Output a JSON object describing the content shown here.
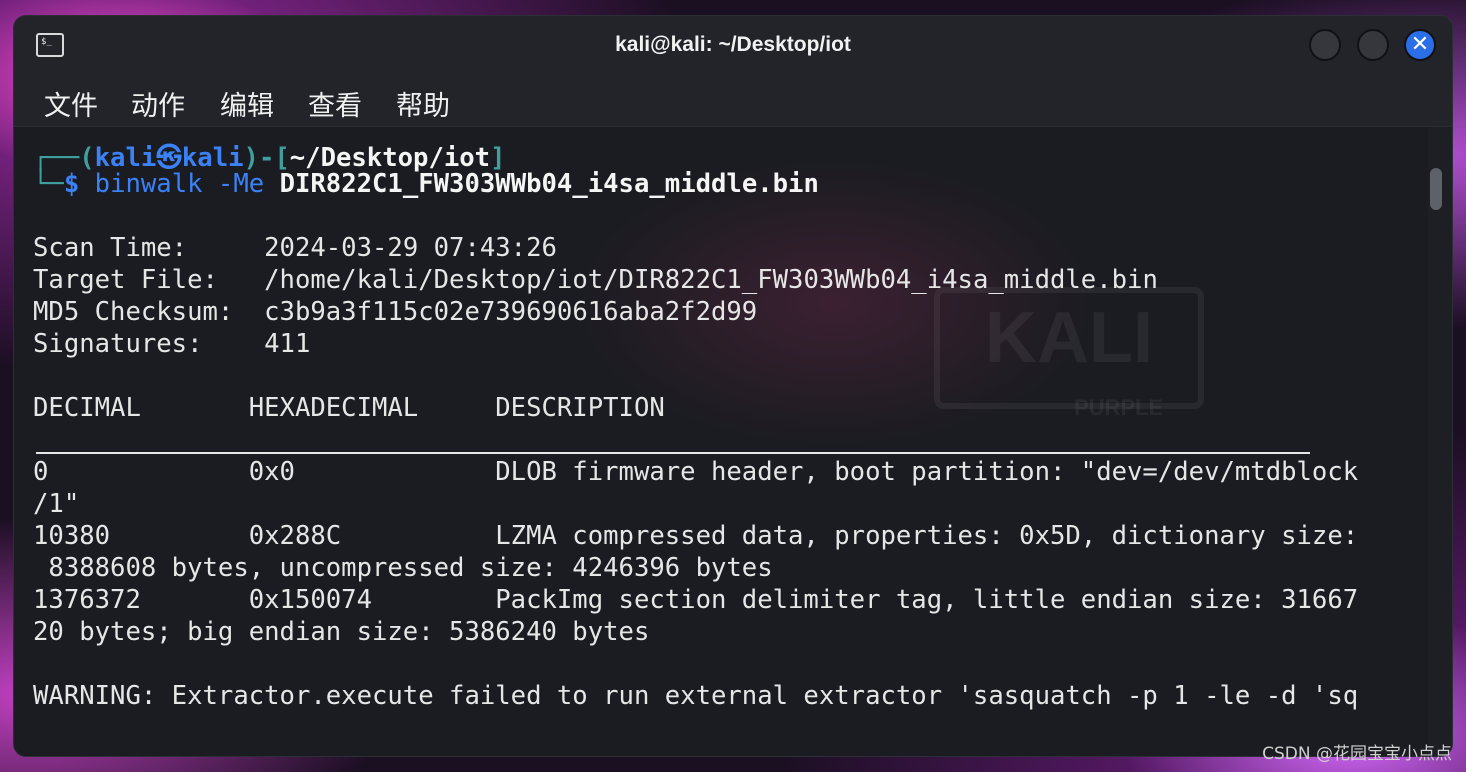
{
  "window": {
    "title": "kali@kali: ~/Desktop/iot",
    "icon": "terminal-icon",
    "icon_glyph": "$_",
    "close_glyph": "✕"
  },
  "menu": [
    "文件",
    "动作",
    "编辑",
    "查看",
    "帮助"
  ],
  "prompt": {
    "line1_prefix": "┌──(",
    "user": "kali",
    "skull": "㉿",
    "host": "kali",
    "mid": ")-[",
    "path": "~/Desktop/iot",
    "end": "]",
    "line2_prefix": "└─",
    "dollar": "$ ",
    "command": "binwalk -Me ",
    "argument": "DIR822C1_FW303WWb04_i4sa_middle.bin"
  },
  "scan": {
    "time_label": "Scan Time:     ",
    "time_value": "2024-03-29 07:43:26",
    "target_label": "Target File:   ",
    "target_value": "/home/kali/Desktop/iot/DIR822C1_FW303WWb04_i4sa_middle.bin",
    "md5_label": "MD5 Checksum:  ",
    "md5_value": "c3b9a3f115c02e739690616aba2f2d99",
    "sig_label": "Signatures:    ",
    "sig_value": "411"
  },
  "table": {
    "header": "DECIMAL       HEXADECIMAL     DESCRIPTION",
    "lines": [
      "0             0x0             DLOB firmware header, boot partition: \"dev=/dev/mtdblock",
      "/1\"",
      "10380         0x288C          LZMA compressed data, properties: 0x5D, dictionary size:",
      " 8388608 bytes, uncompressed size: 4246396 bytes",
      "1376372       0x150074        PackImg section delimiter tag, little endian size: 31667",
      "20 bytes; big endian size: 5386240 bytes"
    ]
  },
  "warning": "WARNING: Extractor.execute failed to run external extractor 'sasquatch -p 1 -le -d 'sq",
  "footer_watermark": "CSDN @花园宝宝小点点",
  "background_watermark": {
    "logo": "KALI",
    "sub": "PURPLE"
  }
}
